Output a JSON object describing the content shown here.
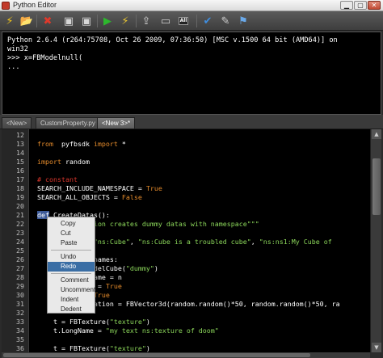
{
  "window": {
    "title": "Python Editor"
  },
  "toolbar": {
    "buttons": [
      {
        "name": "execute-icon",
        "glyph": "⚡",
        "color": "#f0c419"
      },
      {
        "name": "open-folder-icon",
        "glyph": "📂",
        "color": "#e8b64a"
      },
      {
        "name": "close-file-icon",
        "glyph": "✖",
        "color": "#e0392b"
      },
      {
        "name": "save-icon",
        "glyph": "▣",
        "color": "#d7d7d7"
      },
      {
        "name": "save-as-icon",
        "glyph": "▣",
        "color": "#d7d7d7"
      },
      {
        "name": "run-icon",
        "glyph": "▶",
        "color": "#2db82d"
      },
      {
        "name": "run-selection-icon",
        "glyph": "⚡",
        "color": "#e8c531"
      },
      {
        "name": "export-icon",
        "glyph": "⇪",
        "color": "#cfcfcf"
      },
      {
        "name": "clear-icon",
        "glyph": "▭",
        "color": "#cfcfcf"
      },
      {
        "name": "clear-all-icon",
        "glyph": "All",
        "color": "#ffffff"
      },
      {
        "name": "settings-icon",
        "glyph": "✔",
        "color": "#3f8ee0"
      },
      {
        "name": "help-icon",
        "glyph": "✎",
        "color": "#cfcfcf"
      },
      {
        "name": "find-icon",
        "glyph": "⚑",
        "color": "#6aa9e9"
      }
    ]
  },
  "console": {
    "lines": [
      "Python 2.6.4 (r264:75708, Oct 26 2009, 07:36:50) [MSC v.1500 64 bit (AMD64)] on",
      "win32",
      ">>> x=FBModelnull(",
      "..."
    ]
  },
  "tabs": [
    {
      "label": "<New>",
      "active": false
    },
    {
      "label": "CustomProperty.py",
      "active": false
    },
    {
      "label": "<New 3>*",
      "active": true
    }
  ],
  "editor": {
    "lines": [
      {
        "n": "12",
        "segs": []
      },
      {
        "n": "13",
        "segs": [
          [
            "kw",
            "from"
          ],
          [
            "",
            "  pyfbsdk "
          ],
          [
            "kw",
            "import"
          ],
          [
            "",
            " *"
          ]
        ]
      },
      {
        "n": "14",
        "segs": []
      },
      {
        "n": "15",
        "segs": [
          [
            "kw",
            "import"
          ],
          [
            "",
            " random"
          ]
        ]
      },
      {
        "n": "16",
        "segs": []
      },
      {
        "n": "17",
        "segs": [
          [
            "cmt",
            "# constant"
          ]
        ]
      },
      {
        "n": "18",
        "segs": [
          [
            "",
            "SEARCH_INCLUDE_NAMESPACE = "
          ],
          [
            "kw",
            "True"
          ]
        ]
      },
      {
        "n": "19",
        "segs": [
          [
            "",
            "SEARCH_ALL_OBJECTS = "
          ],
          [
            "kw",
            "False"
          ]
        ]
      },
      {
        "n": "20",
        "segs": []
      },
      {
        "n": "21",
        "segs": [
          [
            "sel",
            "def"
          ],
          [
            "",
            " CreateDatas():"
          ]
        ]
      },
      {
        "n": "22",
        "segs": [
          [
            "",
            "         "
          ],
          [
            "str",
            "Function creates dummy datas with namespace\"\"\""
          ]
        ]
      },
      {
        "n": "23",
        "segs": []
      },
      {
        "n": "24",
        "segs": [
          [
            "",
            "           = ["
          ],
          [
            "str",
            "\"ns:Cube\""
          ],
          [
            ", ",
            ", "
          ],
          [
            "str",
            "\"ns:Cube is a troubled cube\""
          ],
          [
            ", ",
            ", "
          ],
          [
            "str",
            "\"ns:ns1:My Cube of"
          ]
        ]
      },
      {
        "n": "25",
        "segs": []
      },
      {
        "n": "26",
        "segs": [
          [
            "",
            "           ubenames:"
          ]
        ]
      },
      {
        "n": "27",
        "segs": [
          [
            "",
            "           BModelCube("
          ],
          [
            "str",
            "\"dummy\""
          ],
          [
            "",
            ")"
          ]
        ]
      },
      {
        "n": "28",
        "segs": [
          [
            "",
            "           ngName = n"
          ]
        ]
      },
      {
        "n": "29",
        "segs": [
          [
            "",
            "           ble = "
          ],
          [
            "kw",
            "True"
          ]
        ]
      },
      {
        "n": "30",
        "segs": [
          [
            "",
            "            = "
          ],
          [
            "kw",
            "True"
          ]
        ]
      },
      {
        "n": "31",
        "segs": [
          [
            "",
            "           nslation = FBVector3d(random.random()*50, random.random()*50, ra"
          ]
        ]
      },
      {
        "n": "32",
        "segs": []
      },
      {
        "n": "33",
        "segs": [
          [
            "",
            "    t = FBTexture("
          ],
          [
            "str",
            "\"texture\""
          ],
          [
            "",
            ")"
          ]
        ]
      },
      {
        "n": "34",
        "segs": [
          [
            "",
            "    t.LongName = "
          ],
          [
            "str",
            "\"my text ns:texture of doom\""
          ]
        ]
      },
      {
        "n": "35",
        "segs": []
      },
      {
        "n": "36",
        "segs": [
          [
            "",
            "    t = FBTexture("
          ],
          [
            "str",
            "\"texture\""
          ],
          [
            "",
            ")"
          ]
        ]
      }
    ]
  },
  "context_menu": {
    "items": [
      {
        "label": "Copy",
        "highlight": false
      },
      {
        "label": "Cut",
        "highlight": false
      },
      {
        "label": "Paste",
        "highlight": false
      },
      {
        "sep": true
      },
      {
        "label": "Undo",
        "highlight": false
      },
      {
        "label": "Redo",
        "highlight": true
      },
      {
        "sep": true
      },
      {
        "label": "Comment",
        "highlight": false
      },
      {
        "label": "Uncomment",
        "highlight": false
      },
      {
        "label": "Indent",
        "highlight": false
      },
      {
        "label": "Dedent",
        "highlight": false
      }
    ]
  }
}
